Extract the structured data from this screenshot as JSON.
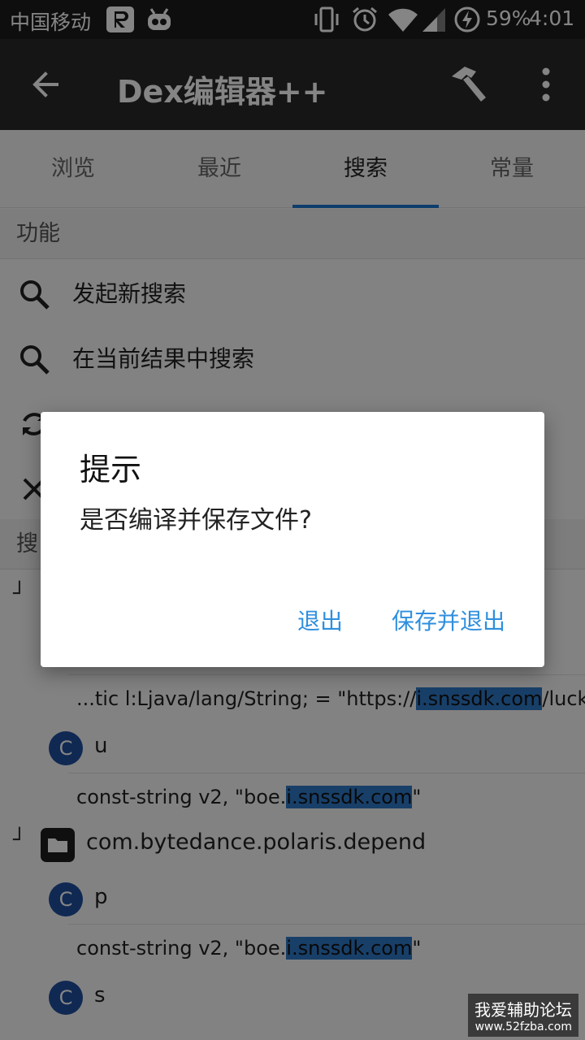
{
  "status_bar": {
    "carrier": "中国移动",
    "battery": "59%",
    "time": "4:01",
    "icons": [
      "r-app-icon",
      "robot-icon",
      "vibrate-icon",
      "alarm-icon",
      "wifi-icon",
      "signal-icon",
      "charging-icon"
    ]
  },
  "toolbar": {
    "title": "Dex编辑器++",
    "back_icon": "back-arrow-icon",
    "build_icon": "hammer-icon",
    "more_icon": "more-vert-icon"
  },
  "tabs": [
    {
      "label": "浏览",
      "active": false
    },
    {
      "label": "最近",
      "active": false
    },
    {
      "label": "搜索",
      "active": true
    },
    {
      "label": "常量",
      "active": false
    }
  ],
  "functions": {
    "header": "功能",
    "items": [
      {
        "label": "发起新搜索",
        "icon": "search-icon"
      },
      {
        "label": "在当前结果中搜索",
        "icon": "search-icon"
      },
      {
        "label": "",
        "icon": "refresh-icon"
      },
      {
        "label": "",
        "icon": "close-icon"
      }
    ]
  },
  "results": {
    "header": "搜",
    "rows": [
      {
        "kind": "code",
        "text_before": "...tic l:Ljava/lang/String; = \"https://",
        "highlight": "i.snssdk.com",
        "text_after": "/luckyc..."
      },
      {
        "kind": "class",
        "badge": "C",
        "name": "u"
      },
      {
        "kind": "code",
        "text_before": "const-string v2, \"boe.",
        "highlight": "i.snssdk.com",
        "text_after": "\""
      },
      {
        "kind": "package",
        "indent": "┘",
        "name": "com.bytedance.polaris.depend",
        "icon": "folder-icon"
      },
      {
        "kind": "class",
        "badge": "C",
        "name": "p"
      },
      {
        "kind": "code",
        "text_before": "const-string v2, \"boe.",
        "highlight": "i.snssdk.com",
        "text_after": "\""
      },
      {
        "kind": "class",
        "badge": "C",
        "name": "s"
      }
    ],
    "hidden_indent": "┘"
  },
  "dialog": {
    "title": "提示",
    "message": "是否编译并保存文件?",
    "buttons": {
      "exit": "退出",
      "save_exit": "保存并退出"
    }
  },
  "watermark": {
    "text": "我爱辅助论坛",
    "url": "www.52fzba.com"
  },
  "colors": {
    "accent": "#1976d2",
    "dialog_button": "#2f8fde",
    "highlight": "#2f79c8",
    "class_badge": "#1f4fa0"
  }
}
